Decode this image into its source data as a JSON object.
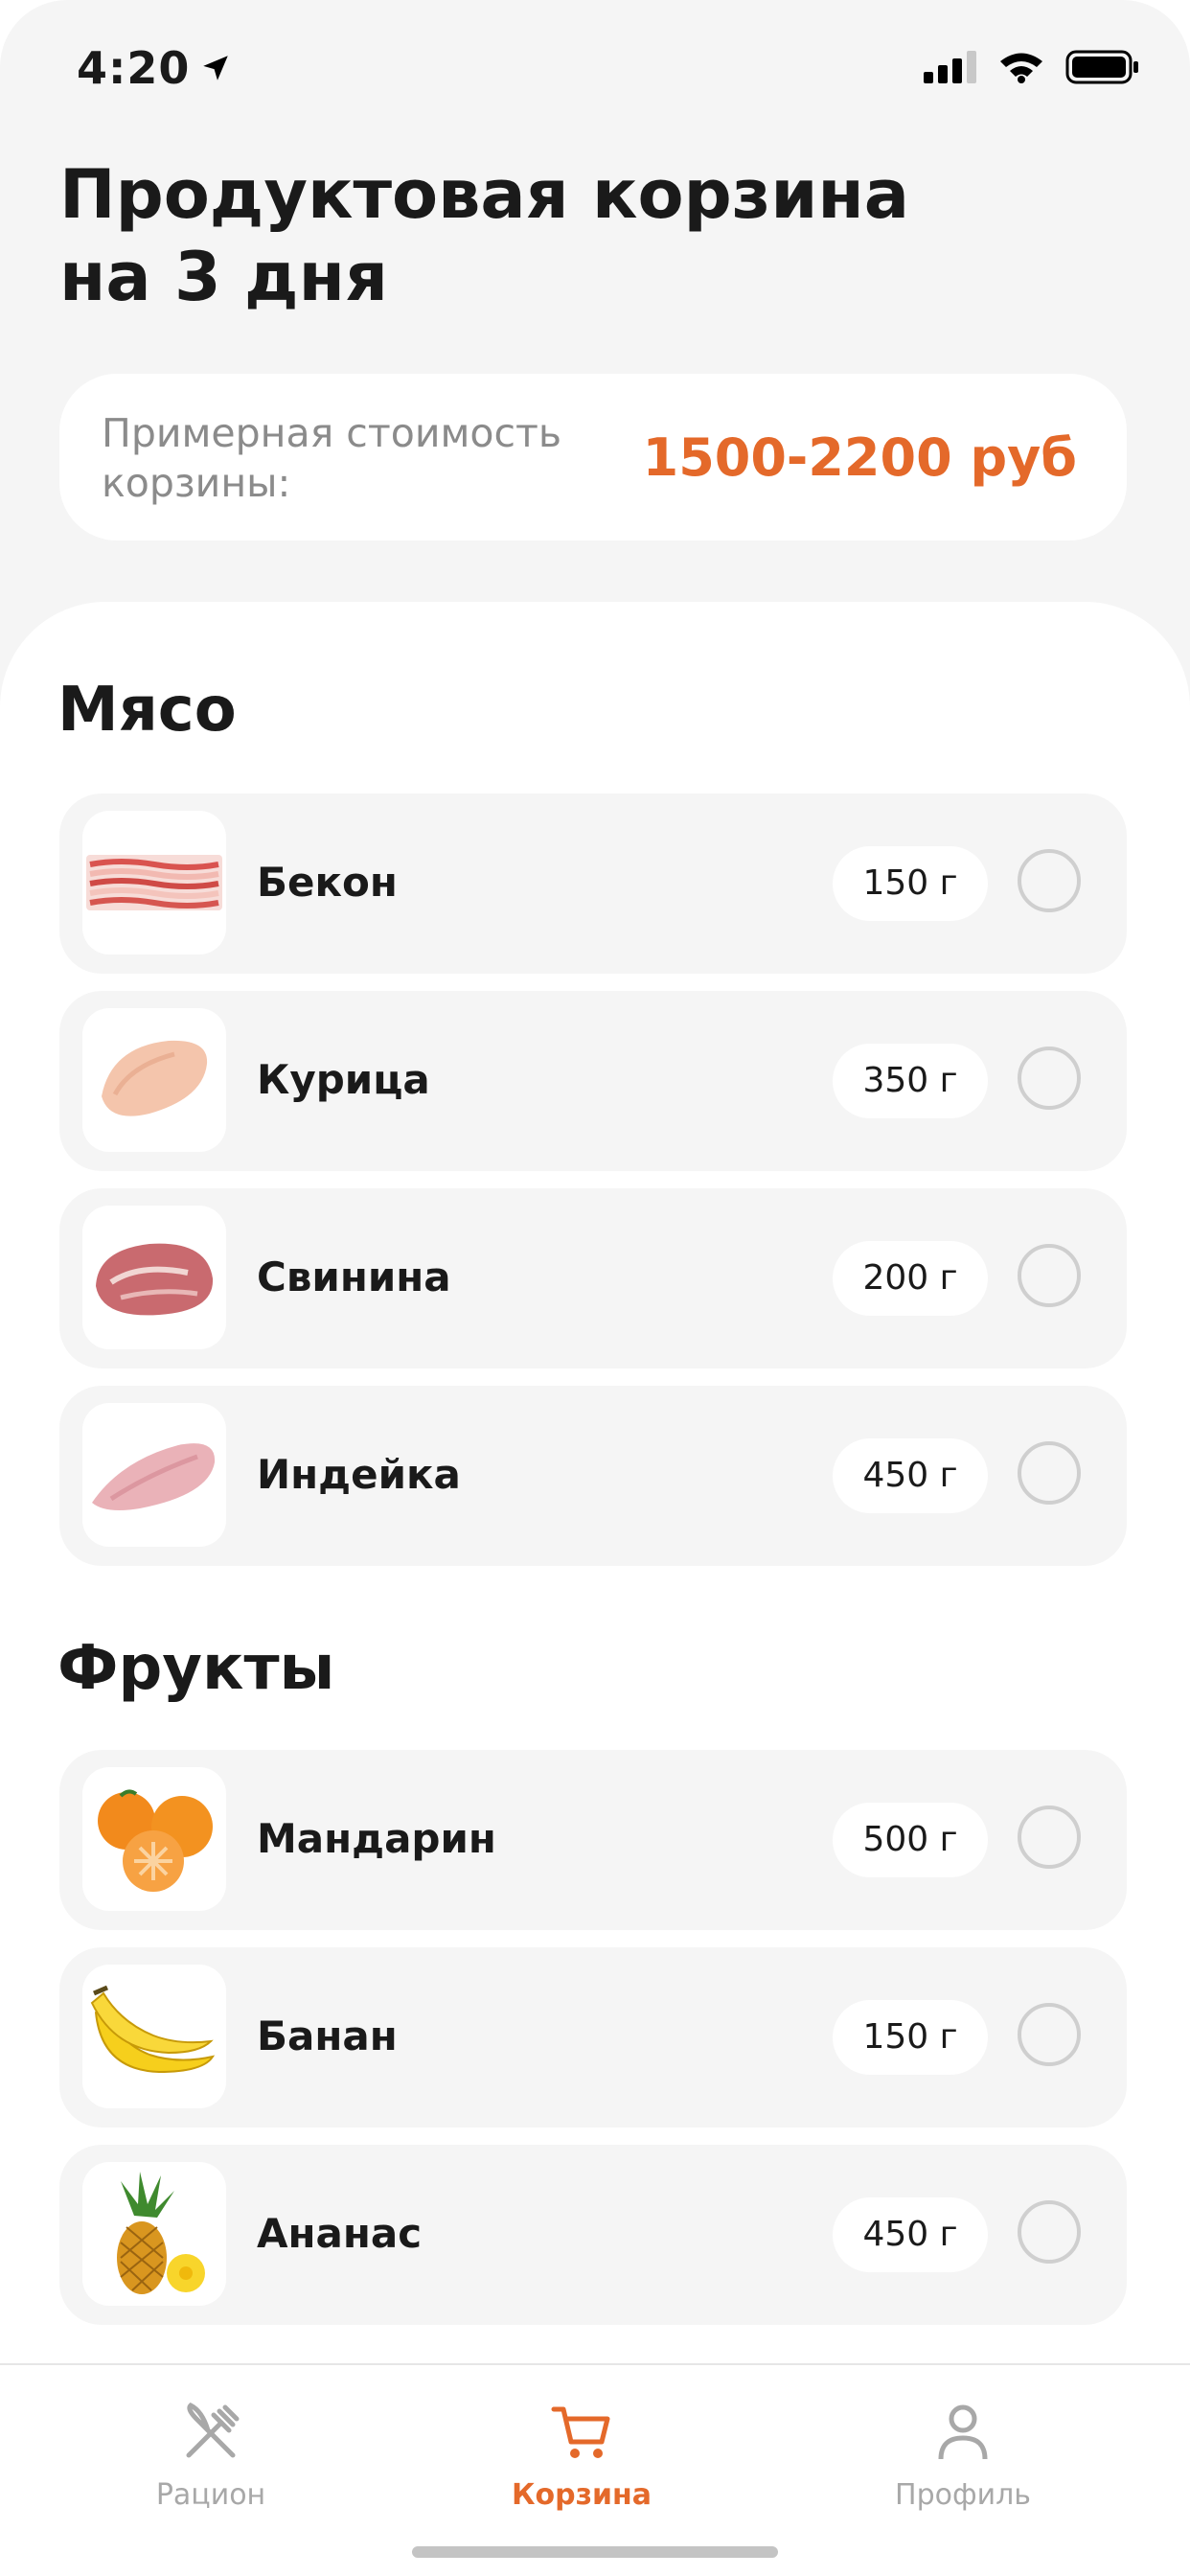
{
  "status_bar": {
    "time": "4:20"
  },
  "header": {
    "title": "Продуктовая корзина на 3 дня"
  },
  "cost": {
    "label": "Примерная стоимость корзины:",
    "value": "1500-2200 руб"
  },
  "sections": [
    {
      "title": "Мясо",
      "items": [
        {
          "name": "Бекон",
          "qty": "150 г",
          "icon": "bacon-image"
        },
        {
          "name": "Курица",
          "qty": "350 г",
          "icon": "chicken-image"
        },
        {
          "name": "Свинина",
          "qty": "200 г",
          "icon": "pork-image"
        },
        {
          "name": "Индейка",
          "qty": "450 г",
          "icon": "turkey-image"
        }
      ]
    },
    {
      "title": "Фрукты",
      "items": [
        {
          "name": "Мандарин",
          "qty": "500 г",
          "icon": "tangerine-image"
        },
        {
          "name": "Банан",
          "qty": "150 г",
          "icon": "banana-image"
        },
        {
          "name": "Ананас",
          "qty": "450 г",
          "icon": "pineapple-image"
        }
      ]
    }
  ],
  "tabbar": {
    "tabs": [
      {
        "label": "Рацион",
        "icon": "fork-knife-icon",
        "active": false
      },
      {
        "label": "Корзина",
        "icon": "cart-icon",
        "active": true
      },
      {
        "label": "Профиль",
        "icon": "person-icon",
        "active": false
      }
    ]
  },
  "colors": {
    "accent": "#e4692a",
    "muted": "#8b8b8b",
    "card": "#f5f5f5"
  }
}
